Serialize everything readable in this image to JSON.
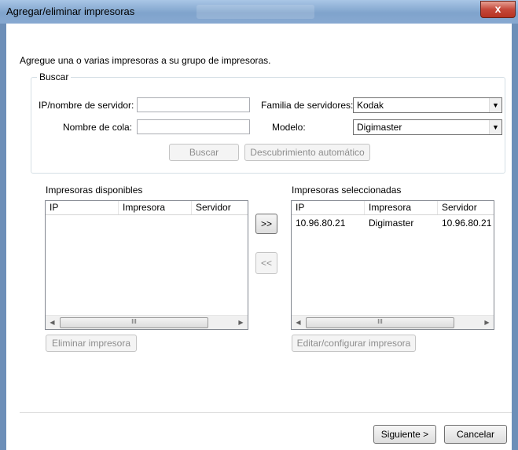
{
  "window": {
    "title": "Agregar/eliminar impresoras",
    "close_label": "x"
  },
  "intro_text": "Agregue una o varias impresoras a su grupo de impresoras.",
  "search": {
    "legend": "Buscar",
    "server_label": "IP/nombre de servidor:",
    "server_value": "",
    "queue_label": "Nombre de cola:",
    "queue_value": "",
    "family_label": "Familia de servidores:",
    "family_value": "Kodak",
    "model_label": "Modelo:",
    "model_value": "Digimaster",
    "search_button": "Buscar",
    "autodiscover_button": "Descubrimiento automático"
  },
  "available": {
    "title": "Impresoras disponibles",
    "columns": [
      "IP",
      "Impresora",
      "Servidor"
    ],
    "rows": [],
    "remove_button": "Eliminar impresora"
  },
  "move": {
    "add_label": ">>",
    "remove_label": "<<"
  },
  "selected": {
    "title": "Impresoras seleccionadas",
    "columns": [
      "IP",
      "Impresora",
      "Servidor"
    ],
    "rows": [
      {
        "ip": "10.96.80.21",
        "printer": "Digimaster",
        "server": "10.96.80.21"
      }
    ],
    "edit_button": "Editar/configurar impresora"
  },
  "scrollbar_thumb": "III",
  "footer": {
    "next_button": "Siguiente >",
    "cancel_button": "Cancelar"
  }
}
